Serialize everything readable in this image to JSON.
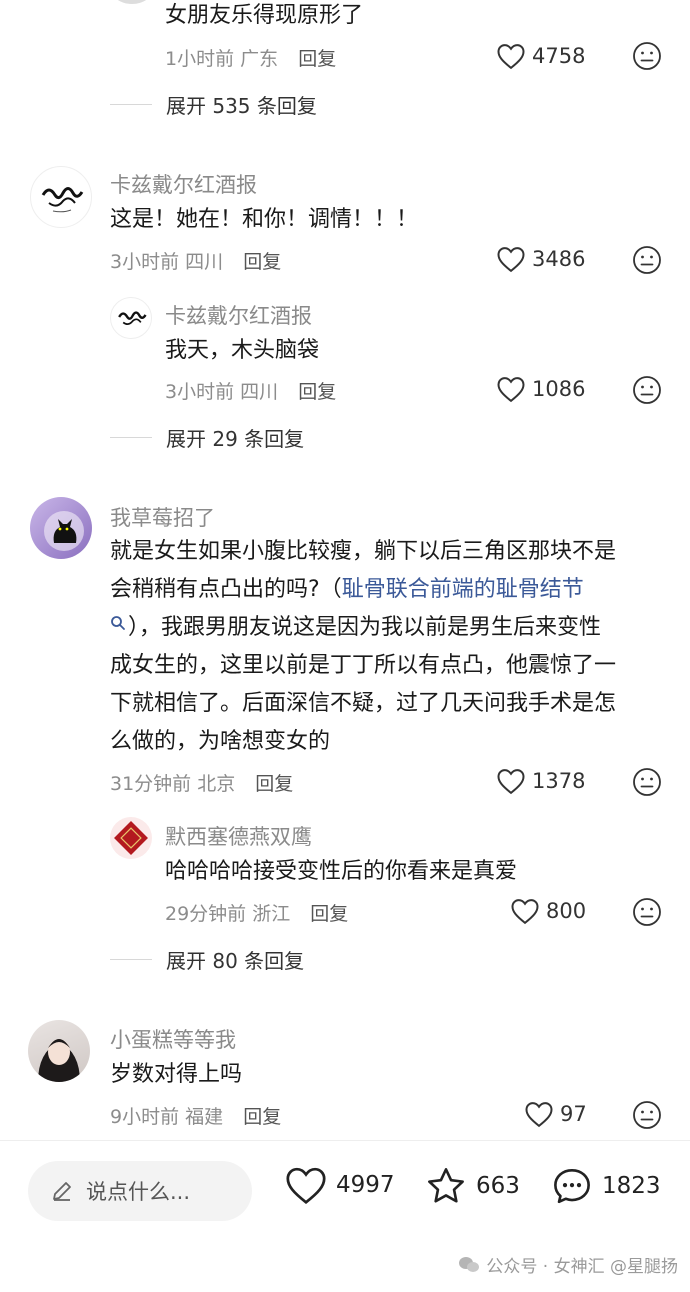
{
  "c1": {
    "reply_text": "女朋友乐得现原形了",
    "time": "1小时前",
    "location": "广东",
    "reply_label": "回复",
    "likes": "4758",
    "expand": "展开 535 条回复"
  },
  "c2": {
    "author": "卡兹戴尔红酒报",
    "text": "这是！她在！和你！调情！！！",
    "time": "3小时前",
    "location": "四川",
    "reply_label": "回复",
    "likes": "3486",
    "sub": {
      "author": "卡兹戴尔红酒报",
      "text": "我天，木头脑袋",
      "time": "3小时前",
      "location": "四川",
      "reply_label": "回复",
      "likes": "1086"
    },
    "expand": "展开 29 条回复"
  },
  "c3": {
    "author": "我草莓招了",
    "line1": "就是女生如果小腹比较瘦，躺下以后三角区那块不是",
    "line2_prefix": "会稍稍有点凸出的吗?（",
    "line2_link": "耻骨联合前端的耻骨结节",
    "line3": "），我跟男朋友说这是因为我以前是男生后来变性",
    "line4": "成女生的，这里以前是丁丁所以有点凸，他震惊了一",
    "line5": "下就相信了。后面深信不疑，过了几天问我手术是怎",
    "line6": "么做的，为啥想变女的",
    "time": "31分钟前",
    "location": "北京",
    "reply_label": "回复",
    "likes": "1378",
    "sub": {
      "author": "默西塞德燕双鹰",
      "text": "哈哈哈哈接受变性后的你看来是真爱",
      "time": "29分钟前",
      "location": "浙江",
      "reply_label": "回复",
      "likes": "800"
    },
    "expand": "展开 80 条回复"
  },
  "c4": {
    "author": "小蛋糕等等我",
    "text": "岁数对得上吗",
    "time": "9小时前",
    "location": "福建",
    "reply_label": "回复",
    "likes": "97"
  },
  "bottom": {
    "placeholder": "说点什么...",
    "likes": "4997",
    "favorites": "663",
    "comments": "1823"
  },
  "watermark": "公众号 · 女神汇  @星腿扬",
  "colors": {
    "link": "#3b5998",
    "meta": "#8c8c8c"
  }
}
